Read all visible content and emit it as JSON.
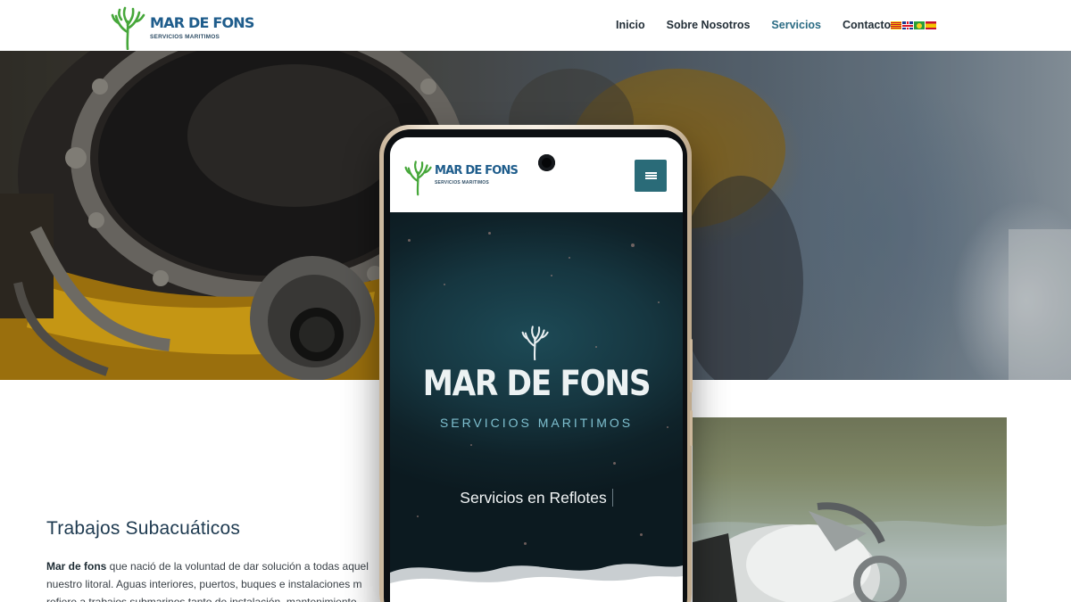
{
  "brand": {
    "wordmark": "MAR DE FONS",
    "tagline": "SERVICIOS MARITIMOS"
  },
  "nav": {
    "items": [
      "Inicio",
      "Sobre Nosotros",
      "Servicios",
      "Contacto"
    ],
    "active_index": 2
  },
  "languages": [
    "Català",
    "English",
    "Português",
    "Español"
  ],
  "colors": {
    "accent_teal": "#2b6c84",
    "menu_button": "#2a6b78",
    "brand_green": "#46a73a",
    "brand_blue": "#1f5d8c"
  },
  "section": {
    "title": "Trabajos Subacuáticos",
    "intro_bold": "Mar de fons",
    "intro_rest": " que nació de la voluntad de dar solución a todas aquel",
    "line2": "nuestro litoral. Aguas interiores, puertos, buques e instalaciones m",
    "line3": "refiere a trabajos submarinos tanto de instalación, mantenimiento"
  },
  "mobile": {
    "menu_icon": "hamburger-icon",
    "hero_title": "MAR DE FONS",
    "hero_subtitle": "SERVICIOS MARITIMOS",
    "typed_prefix": "Servicios en",
    "typed_word": "Reflotes"
  }
}
